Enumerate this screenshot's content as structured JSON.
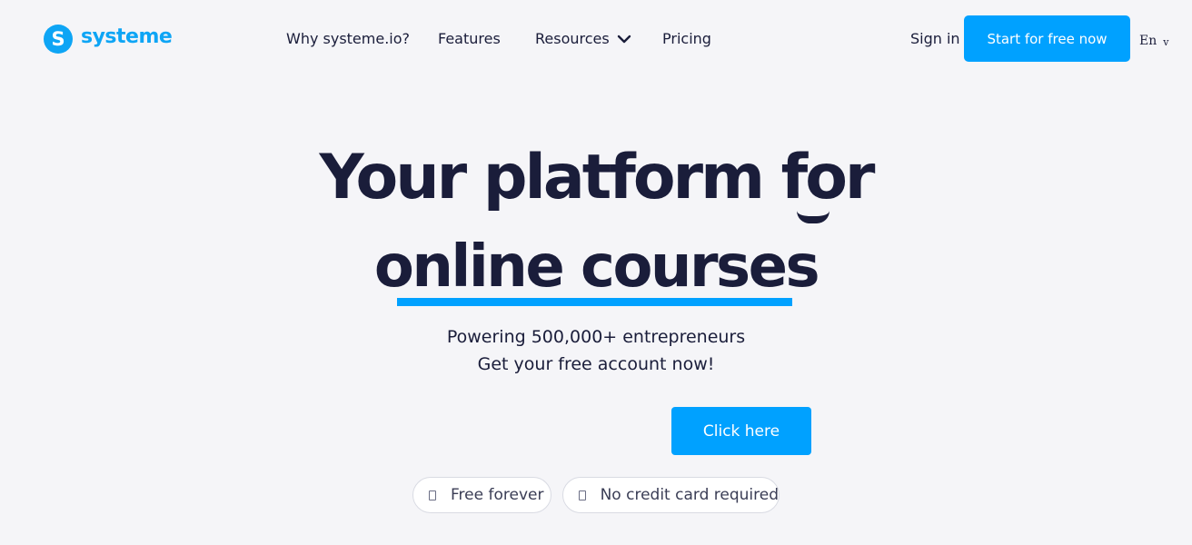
{
  "header": {
    "logo_text": "systeme",
    "logo_mark": "S",
    "nav": [
      "Why systeme.io?",
      "Features",
      "Resources",
      "Pricing"
    ],
    "sign_in": "Sign in",
    "cta": "Start for free now",
    "language": "En",
    "language_caret": "v"
  },
  "hero": {
    "title_line1": "Your platform for",
    "title_line2": "online courses",
    "subtitle_line1": "Powering 500,000+ entrepreneurs",
    "subtitle_line2": "Get your free account now!",
    "cta": "Click here",
    "badges": [
      "Free forever",
      "No credit card required"
    ]
  },
  "colors": {
    "accent": "#00a1ff",
    "text": "#1a1d3a",
    "background": "#f5f5f8"
  },
  "icons": {
    "resources_dropdown": "chevron-down-icon",
    "badge": "check-icon"
  }
}
